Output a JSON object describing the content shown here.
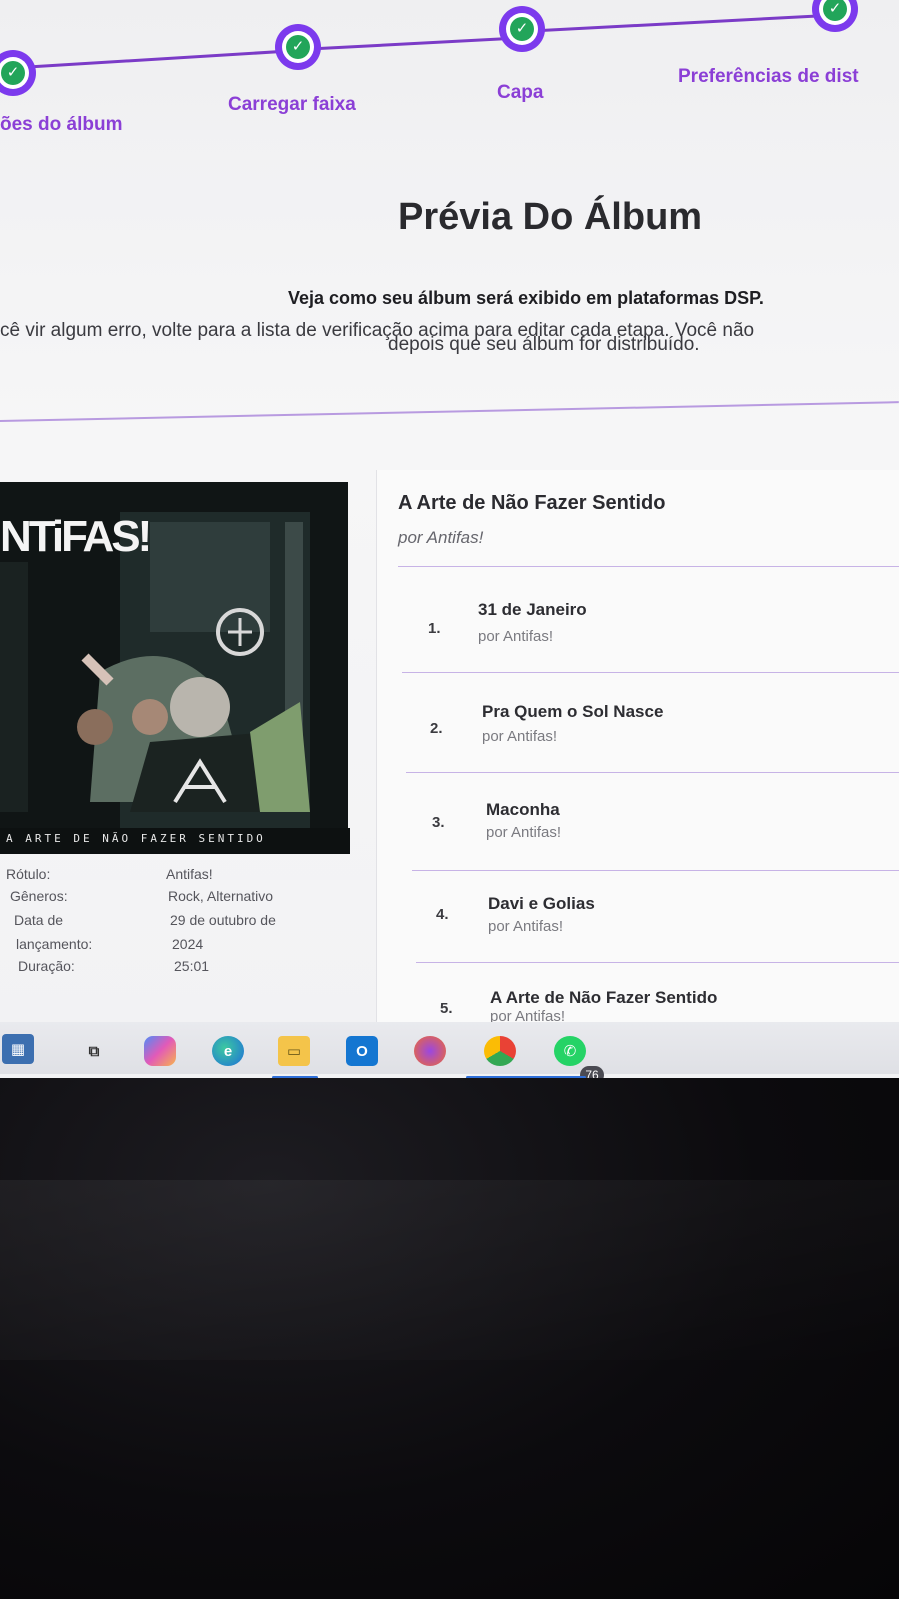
{
  "stepper": {
    "steps": [
      {
        "label": "ões do álbum"
      },
      {
        "label": "Carregar faixa"
      },
      {
        "label": "Capa"
      },
      {
        "label": "Preferências de dist"
      }
    ]
  },
  "page": {
    "title": "Prévia Do Álbum",
    "subtitle": "Veja como seu álbum será exibido em plataformas DSP.",
    "info_line1": "cê vir algum erro, volte para a lista de verificação acima para editar cada etapa. Você não",
    "info_line2": "depois que seu álbum for distribuído."
  },
  "cover": {
    "logo_text": "NTiFAS!",
    "caption": "A ARTE DE NÃO FAZER SENTIDO"
  },
  "metadata": {
    "label_label": "Rótulo:",
    "label_value": "Antifas!",
    "genres_label": "Gêneros:",
    "genres_value": "Rock, Alternativo",
    "release_label_1": "Data de",
    "release_label_2": "lançamento:",
    "release_value_1": "29 de outubro de",
    "release_value_2": "2024",
    "duration_label": "Duração:",
    "duration_value": "25:01"
  },
  "album": {
    "name": "A Arte de Não Fazer Sentido",
    "artist": "por Antifas!"
  },
  "tracks": [
    {
      "num": "1.",
      "title": "31 de Janeiro",
      "artist": "por Antifas!"
    },
    {
      "num": "2.",
      "title": "Pra Quem o Sol Nasce",
      "artist": "por Antifas!"
    },
    {
      "num": "3.",
      "title": "Maconha",
      "artist": "por Antifas!"
    },
    {
      "num": "4.",
      "title": "Davi e Golias",
      "artist": "por Antifas!"
    },
    {
      "num": "5.",
      "title": "A Arte de Não Fazer Sentido",
      "artist": "por Antifas!"
    }
  ],
  "taskbar": {
    "whatsapp_badge": "76"
  },
  "colors": {
    "accent": "#7c3aed",
    "check": "#22a55a",
    "step_label": "#8b3fd6"
  }
}
